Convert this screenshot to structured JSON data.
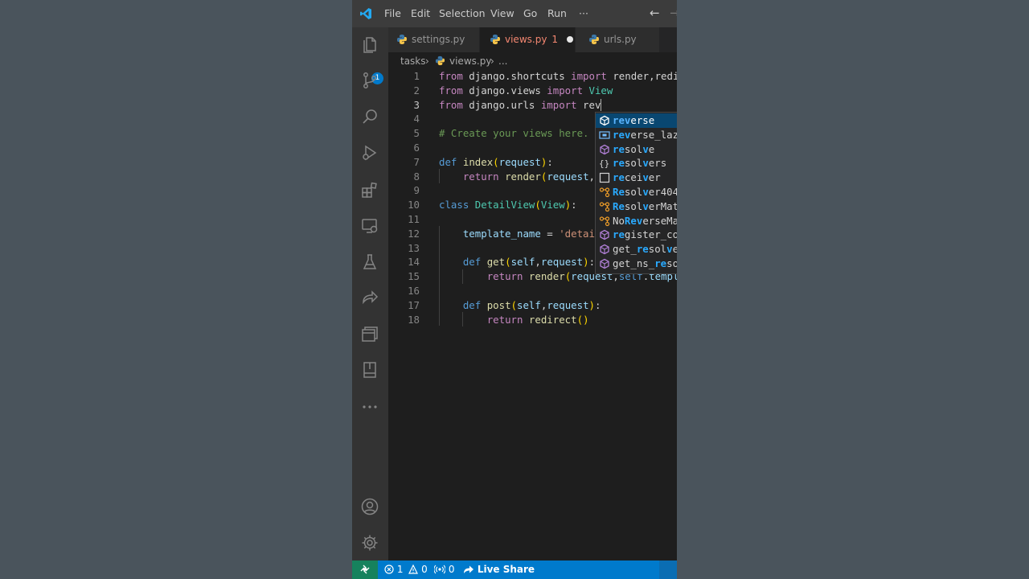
{
  "menu": [
    "File",
    "Edit",
    "Selection",
    "View",
    "Go",
    "Run",
    "···"
  ],
  "titlebar": {
    "back_glyph": "←",
    "forward_glyph": "→"
  },
  "activity": {
    "explorer_badge": "1",
    "icons": [
      "files-icon",
      "source-control-icon",
      "search-icon",
      "run-debug-icon",
      "extensions-icon",
      "remote-explorer-icon",
      "testing-icon",
      "live-share-icon",
      "panels-icon",
      "bookmark-icon",
      "more-icon",
      "account-icon",
      "settings-gear-icon"
    ]
  },
  "tabs": [
    {
      "label": "settings.py",
      "active": false
    },
    {
      "label": "views.py",
      "active": true,
      "problems": "1",
      "dirty": true
    },
    {
      "label": "urls.py",
      "active": false
    }
  ],
  "breadcrumb": {
    "folder": "tasks",
    "file": "views.py",
    "more": "..."
  },
  "editor": {
    "cursor_line": 3,
    "lines": [
      {
        "n": "1",
        "html": "<span class=\"ctl\">from</span> django.shortcuts <span class=\"ctl\">import</span> render,redirect"
      },
      {
        "n": "2",
        "html": "<span class=\"ctl\">from</span> django.views <span class=\"ctl\">import</span> <span class=\"cls\">View</span>"
      },
      {
        "n": "3",
        "html": "<span class=\"ctl\">from</span> django.urls <span class=\"ctl\">import</span> rev<span class=\"cursor\"></span>"
      },
      {
        "n": "4",
        "html": ""
      },
      {
        "n": "5",
        "html": "<span class=\"cmt\"># Create your views here.</span>"
      },
      {
        "n": "6",
        "html": ""
      },
      {
        "n": "7",
        "html": "<span class=\"kw\">def</span> <span class=\"fn\">index</span><span class=\"paren\">(</span><span class=\"var\">request</span><span class=\"paren\">)</span>:"
      },
      {
        "n": "8",
        "html": "    <span class=\"ctl\">return</span> <span class=\"fn\">render</span><span class=\"paren\">(</span><span class=\"var\">request</span>,<span class=\"str\">'tasks/index.html'</span><span class=\"paren\">)</span>"
      },
      {
        "n": "9",
        "html": ""
      },
      {
        "n": "10",
        "html": "<span class=\"kw\">class</span> <span class=\"cls\">DetailView</span><span class=\"paren\">(</span><span class=\"cls\">View</span><span class=\"paren\">)</span>:"
      },
      {
        "n": "11",
        "html": ""
      },
      {
        "n": "12",
        "html": "    <span class=\"var\">template_name</span> = <span class=\"str\">'detail.html'</span>"
      },
      {
        "n": "13",
        "html": ""
      },
      {
        "n": "14",
        "html": "    <span class=\"kw\">def</span> <span class=\"fn\">get</span><span class=\"paren\">(</span><span class=\"var\">self</span>,<span class=\"var\">request</span><span class=\"paren\">)</span>:"
      },
      {
        "n": "15",
        "html": "        <span class=\"ctl\">return</span> <span class=\"fn\">render</span><span class=\"paren\">(</span><span class=\"var\">request</span>,<span class=\"kw\">self</span>.<span class=\"var\">template_name</span><span class=\"paren\">)</span>"
      },
      {
        "n": "16",
        "html": ""
      },
      {
        "n": "17",
        "html": "    <span class=\"kw\">def</span> <span class=\"fn\">post</span><span class=\"paren\">(</span><span class=\"var\">self</span>,<span class=\"var\">request</span><span class=\"paren\">)</span>:"
      },
      {
        "n": "18",
        "html": "        <span class=\"ctl\">return</span> <span class=\"fn\">redirect</span><span class=\"paren\">()</span>"
      }
    ]
  },
  "suggest": {
    "items": [
      {
        "pre": "",
        "hl": "rev",
        "rest": "erse",
        "kind": "function",
        "selected": true
      },
      {
        "pre": "",
        "hl": "rev",
        "rest": "erse_lazy",
        "kind": "variable"
      },
      {
        "pre": "",
        "hl": "re",
        "mid": "sol",
        "hl2": "v",
        "rest": "e",
        "kind": "module"
      },
      {
        "pre": "",
        "hl": "re",
        "mid": "sol",
        "hl2": "v",
        "rest": "ers",
        "kind": "namespace"
      },
      {
        "pre": "",
        "hl": "re",
        "mid": "cei",
        "hl2": "v",
        "rest": "er",
        "kind": "text"
      },
      {
        "pre": "",
        "hl": "Re",
        "mid": "sol",
        "hl2": "v",
        "rest": "er404",
        "kind": "class"
      },
      {
        "pre": "",
        "hl": "Re",
        "mid": "sol",
        "hl2": "v",
        "rest": "erMatch",
        "kind": "class"
      },
      {
        "pre": "No",
        "hl": "Rev",
        "rest": "erseMatch",
        "kind": "class"
      },
      {
        "pre": "",
        "hl": "re",
        "mid": "gister_con",
        "hl2": "v",
        "rest": "erter",
        "kind": "module"
      },
      {
        "pre": "get_",
        "hl": "re",
        "mid": "sol",
        "hl2": "v",
        "rest": "er",
        "kind": "module"
      },
      {
        "pre": "get_ns_",
        "hl": "re",
        "mid": "sol",
        "hl2": "v",
        "rest": "er",
        "kind": "module"
      }
    ]
  },
  "status": {
    "errors": "1",
    "warnings": "0",
    "ports": "0",
    "live_share": "Live Share"
  },
  "colors": {
    "accent": "#007acc",
    "remote": "#16825d",
    "editor_bg": "#1e1e1e",
    "activity_bg": "#333333"
  }
}
